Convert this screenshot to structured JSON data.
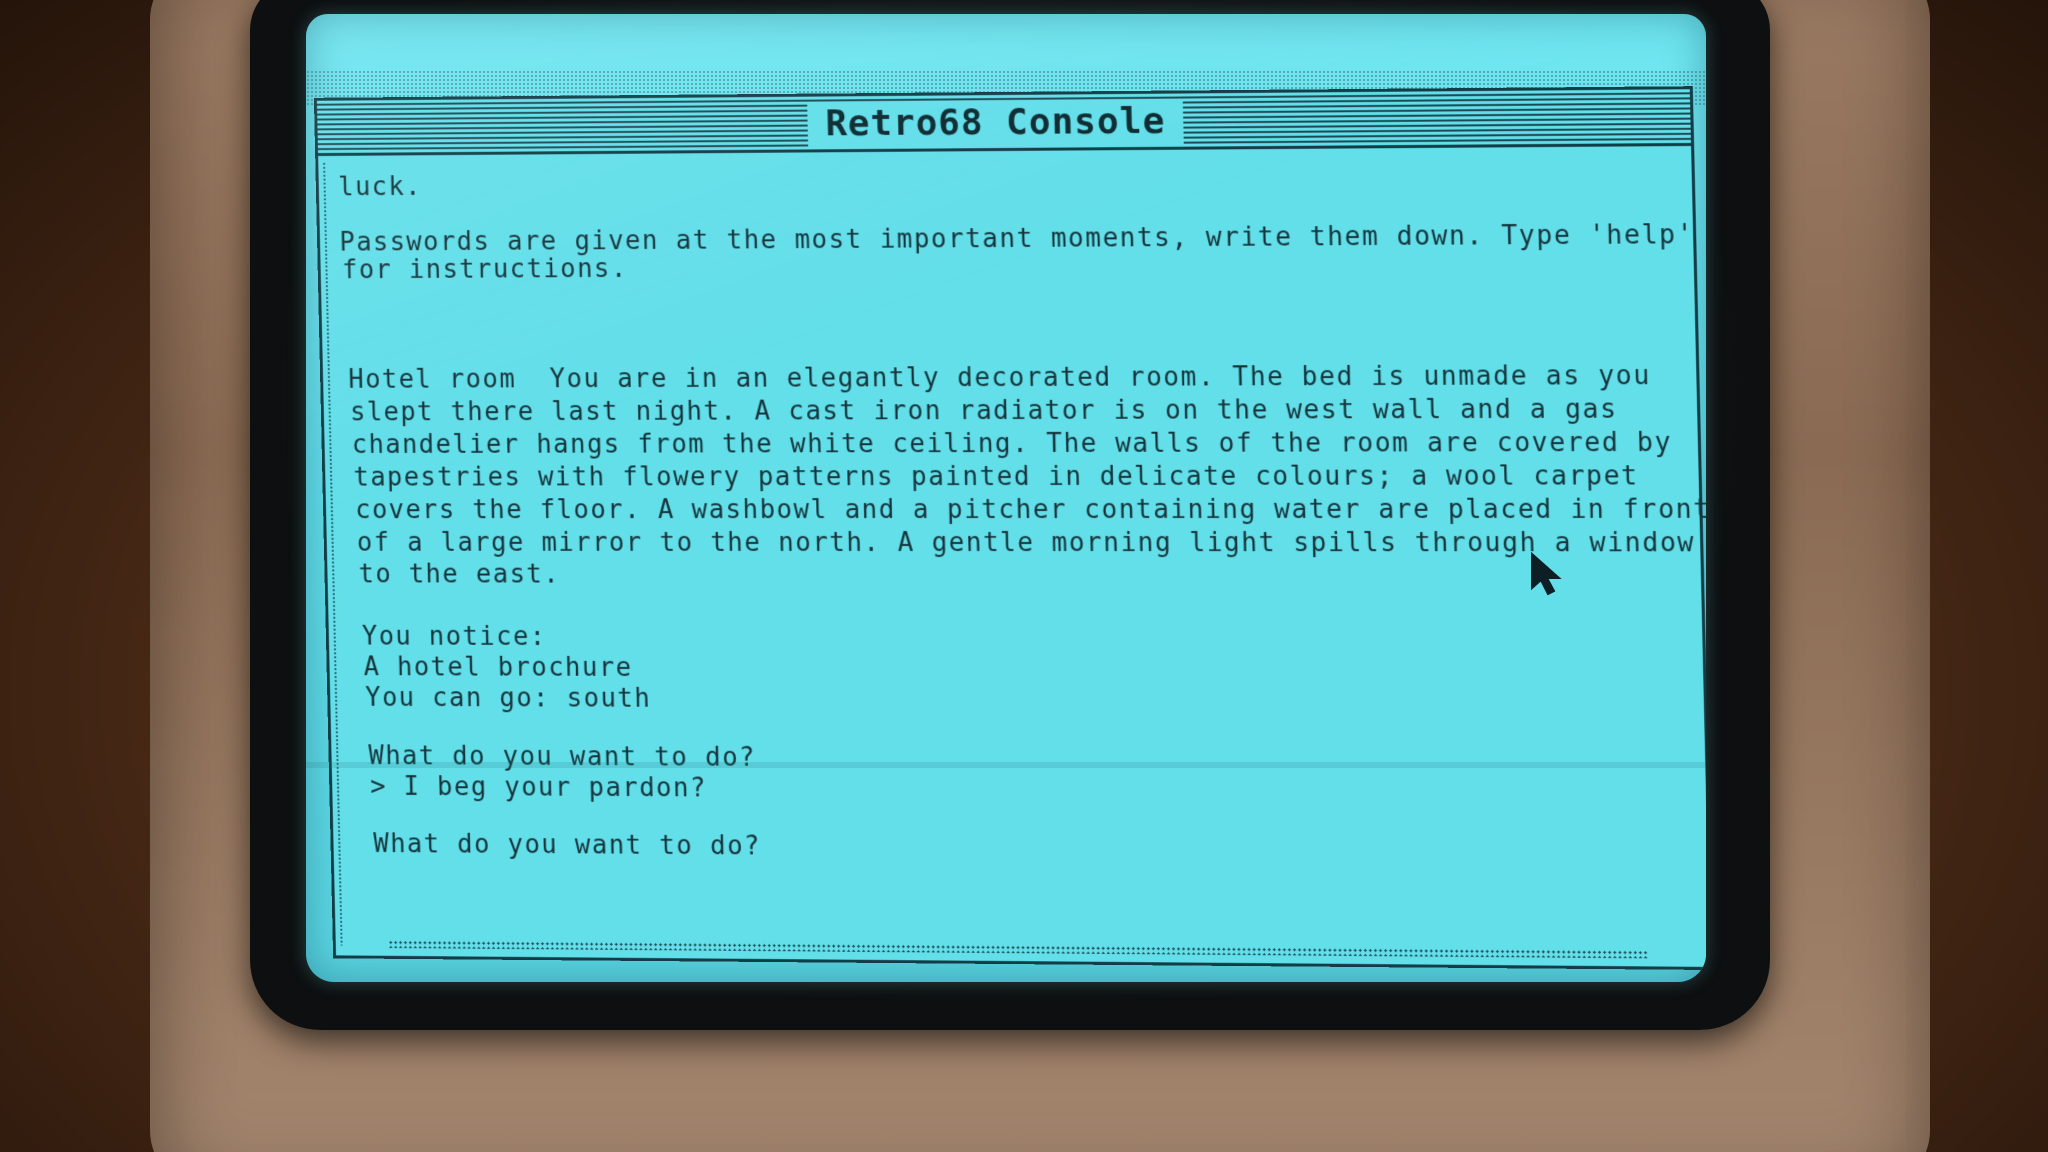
{
  "window": {
    "title": "Retro68 Console"
  },
  "console": {
    "lines": [
      "luck.",
      "Passwords are given at the most important moments, write them down. Type 'help'",
      "for instructions.",
      "Hotel room  You are in an elegantly decorated room. The bed is unmade as you",
      "slept there last night. A cast iron radiator is on the west wall and a gas",
      "chandelier hangs from the white ceiling. The walls of the room are covered by",
      "tapestries with flowery patterns painted in delicate colours; a wool carpet",
      "covers the floor. A washbowl and a pitcher containing water are placed in front",
      "of a large mirror to the north. A gentle morning light spills through a window",
      "to the east.",
      "You notice:",
      "A hotel brochure",
      "You can go: south",
      "What do you want to do?",
      "> I beg your pardon?",
      "What do you want to do?"
    ]
  },
  "colors": {
    "screen": "#63dfea",
    "text": "#15343b",
    "bezel": "#0d0f10",
    "case": "#9a7a62"
  },
  "icons": {
    "pointer": "arrow-cursor-icon"
  }
}
